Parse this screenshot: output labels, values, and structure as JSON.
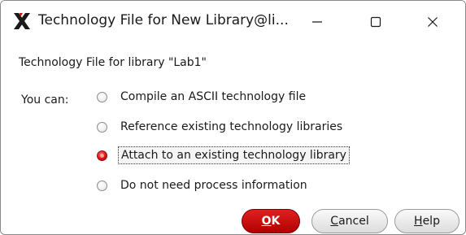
{
  "window": {
    "title": "Technology File for New Library@li...",
    "app_icon": "cadence-x-icon",
    "controls": {
      "minimize": "minimize-icon",
      "maximize": "maximize-icon",
      "close": "close-icon"
    }
  },
  "dialog": {
    "heading": "Technology File for library \"Lab1\"",
    "you_can_label": "You can:",
    "options": [
      {
        "label": "Compile an ASCII technology file",
        "checked": false
      },
      {
        "label": "Reference existing technology libraries",
        "checked": false
      },
      {
        "label": "Attach to an existing technology library",
        "checked": true
      },
      {
        "label": "Do not need process information",
        "checked": false
      }
    ]
  },
  "buttons": {
    "ok": {
      "mnemonic": "O",
      "rest": "K"
    },
    "cancel": {
      "mnemonic": "C",
      "rest": "ancel"
    },
    "help": {
      "mnemonic": "H",
      "rest": "elp"
    }
  },
  "colors": {
    "accent": "#d01010",
    "radio_checked": "#e01010"
  }
}
